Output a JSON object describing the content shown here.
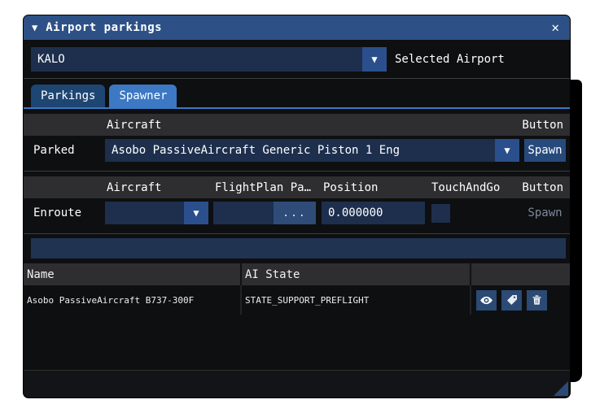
{
  "window": {
    "title": "Airport parkings"
  },
  "icons": {
    "caret": "▼",
    "collapse": "▼",
    "close": "✕"
  },
  "airport": {
    "value": "KALO",
    "label": "Selected Airport"
  },
  "tabs": [
    {
      "label": "Parkings",
      "active": false
    },
    {
      "label": "Spawner",
      "active": true
    }
  ],
  "parked": {
    "header": {
      "aircraft": "Aircraft",
      "button": "Button"
    },
    "row_label": "Parked",
    "aircraft_value": "Asobo PassiveAircraft Generic Piston 1 Eng",
    "spawn_label": "Spawn"
  },
  "enroute": {
    "header": {
      "aircraft": "Aircraft",
      "flightplan": "FlightPlan Pa…",
      "position": "Position",
      "touchandgo": "TouchAndGo",
      "button": "Button"
    },
    "row_label": "Enroute",
    "aircraft_value": "",
    "flightplan_value": "",
    "browse_label": "...",
    "position_value": "0.000000",
    "spawn_label": "Spawn",
    "touchandgo_checked": false
  },
  "ai_table": {
    "columns": {
      "name": "Name",
      "state": "AI State"
    },
    "rows": [
      {
        "name": "Asobo PassiveAircraft B737-300F",
        "state": "STATE_SUPPORT_PREFLIGHT"
      }
    ]
  },
  "colors": {
    "titlebar": "#2d5186",
    "accent": "#3c78c4",
    "field": "#1d2f4d",
    "button": "#274a7d",
    "caret_button": "#2a4f8c",
    "header_row": "#2e2e31",
    "status_bar": "#203452",
    "icon_button": "#2b4a74",
    "disabled_text": "#7e899c",
    "window_bg": "#0e0f11"
  }
}
